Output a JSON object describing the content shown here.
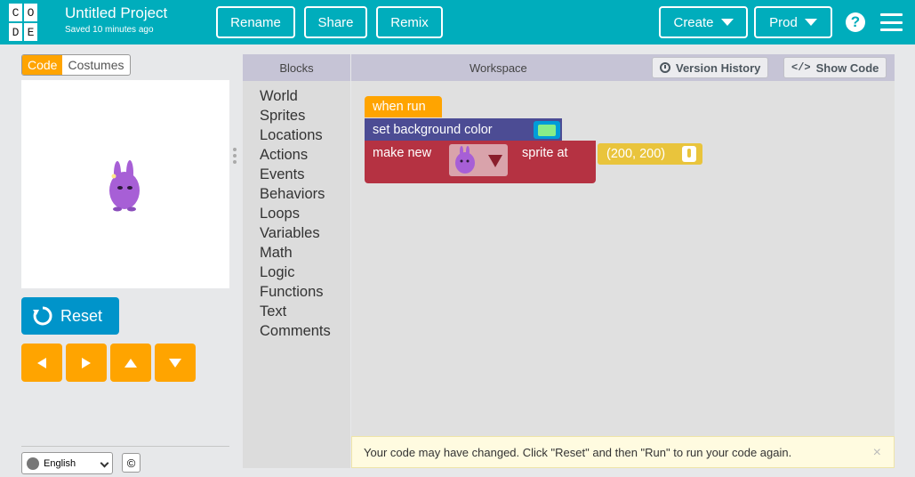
{
  "header": {
    "logo_letters": [
      "C",
      "O",
      "D",
      "E"
    ],
    "project_title": "Untitled Project",
    "saved_status": "Saved 10 minutes ago",
    "rename_label": "Rename",
    "share_label": "Share",
    "remix_label": "Remix",
    "create_label": "Create",
    "prod_label": "Prod",
    "help_glyph": "?"
  },
  "left_panel": {
    "mode_tabs": [
      {
        "label": "Code",
        "active": true
      },
      {
        "label": "Costumes",
        "active": false
      }
    ],
    "reset_label": "Reset",
    "arrow_buttons": [
      "left-arrow-icon",
      "right-arrow-icon",
      "up-arrow-icon",
      "down-arrow-icon"
    ],
    "language": "English",
    "copyright_glyph": "©"
  },
  "toolbox": {
    "header": "Blocks",
    "categories": [
      "World",
      "Sprites",
      "Locations",
      "Actions",
      "Events",
      "Behaviors",
      "Loops",
      "Variables",
      "Math",
      "Logic",
      "Functions",
      "Text",
      "Comments"
    ]
  },
  "workspace": {
    "header": "Workspace",
    "version_history_label": "Version History",
    "show_code_label": "Show Code",
    "code_glyph": "</>",
    "blocks": {
      "when_run": "when run",
      "set_background": "set background color",
      "make_new": "make new",
      "sprite_at": "sprite at",
      "location": "(200, 200)"
    },
    "notice": "Your code may have changed. Click \"Reset\" and then \"Run\" to run your code again.",
    "notice_close": "×"
  },
  "colors": {
    "header_bg": "#00adbc",
    "accent_orange": "#ffa400",
    "reset_blue": "#0094ca",
    "world_block": "#4c4c94",
    "sprite_block": "#b53242",
    "location_block": "#e9c43c",
    "swatch_green": "#88ee88",
    "sprite_purple": "#a75fd6"
  }
}
